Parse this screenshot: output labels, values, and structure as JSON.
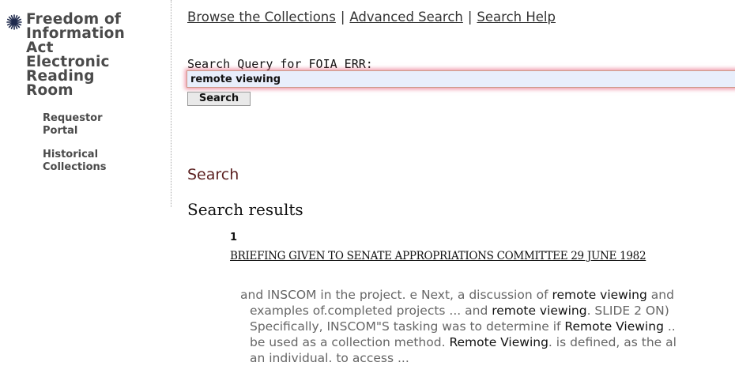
{
  "sidebar": {
    "title_lines": [
      "Freedom of",
      "Information",
      "Act",
      "Electronic",
      "Reading",
      "Room"
    ],
    "links": [
      {
        "lines": [
          "Requestor",
          "Portal"
        ]
      },
      {
        "lines": [
          "Historical",
          "Collections"
        ]
      }
    ]
  },
  "topnav": {
    "browse": "Browse the Collections",
    "sep": "|",
    "advanced": "Advanced Search",
    "help": "Search Help"
  },
  "search_form": {
    "label": "Search Query for FOIA ERR:",
    "query": "remote viewing",
    "button": "Search"
  },
  "main": {
    "search_heading": "Search",
    "results_heading": "Search results"
  },
  "results": [
    {
      "number": "1",
      "title": "BRIEFING GIVEN TO SENATE APPROPRIATIONS COMMITTEE 29 JUNE 1982",
      "snippet_lines": [
        [
          {
            "t": "and INSCOM in the project. e Next, a discussion of "
          },
          {
            "t": "remote viewing",
            "hl": true
          },
          {
            "t": " and"
          }
        ],
        [
          {
            "t": "examples of.completed projects ... and "
          },
          {
            "t": "remote viewing",
            "hl": true
          },
          {
            "t": ". SLIDE 2 ON)"
          }
        ],
        [
          {
            "t": "Specifically, INSCOM\"S tasking was to determine if "
          },
          {
            "t": "Remote Viewing",
            "hl": true
          },
          {
            "t": " .."
          }
        ],
        [
          {
            "t": "be used as a collection method. "
          },
          {
            "t": "Remote Viewing",
            "hl": true
          },
          {
            "t": ". is defined, as the al"
          }
        ],
        [
          {
            "t": "an individual. to access ..."
          }
        ]
      ]
    }
  ],
  "colors": {
    "accent_heading": "#5a1f1f",
    "input_highlight": "#e65070",
    "input_bg": "#e8eefb"
  },
  "icons": {
    "logo": "star-burst-icon"
  }
}
